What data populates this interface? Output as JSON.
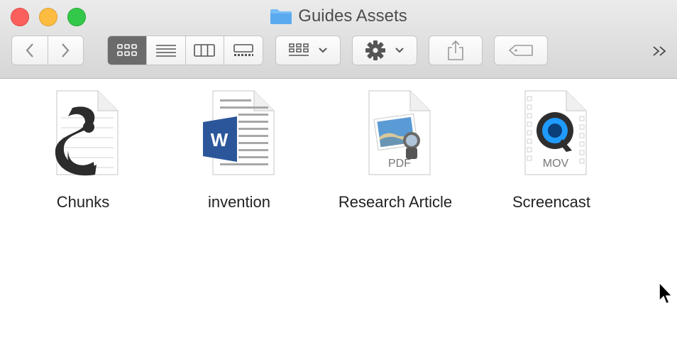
{
  "window": {
    "title": "Guides Assets",
    "title_icon": "folder-icon"
  },
  "toolbar": {
    "back_icon": "chevron-left-icon",
    "forward_icon": "chevron-right-icon",
    "view_modes": [
      "icon-view",
      "list-view",
      "column-view",
      "gallery-view"
    ],
    "active_view": "icon-view",
    "group_icon": "group-by-icon",
    "action_icon": "gear-icon",
    "share_icon": "share-icon",
    "tag_icon": "tag-icon",
    "overflow_label": ">>"
  },
  "files": [
    {
      "name": "Chunks",
      "icon": "scrivener-document-icon"
    },
    {
      "name": "invention",
      "icon": "word-document-icon"
    },
    {
      "name": "Research Article",
      "icon": "pdf-document-icon",
      "badge": "PDF"
    },
    {
      "name": "Screencast",
      "icon": "quicktime-movie-icon",
      "badge": "MOV"
    }
  ],
  "colors": {
    "close": "#fc605c",
    "minimize": "#fdbc40",
    "zoom": "#34c84a",
    "folder": "#6fb7f5",
    "word_blue": "#2b579a"
  }
}
